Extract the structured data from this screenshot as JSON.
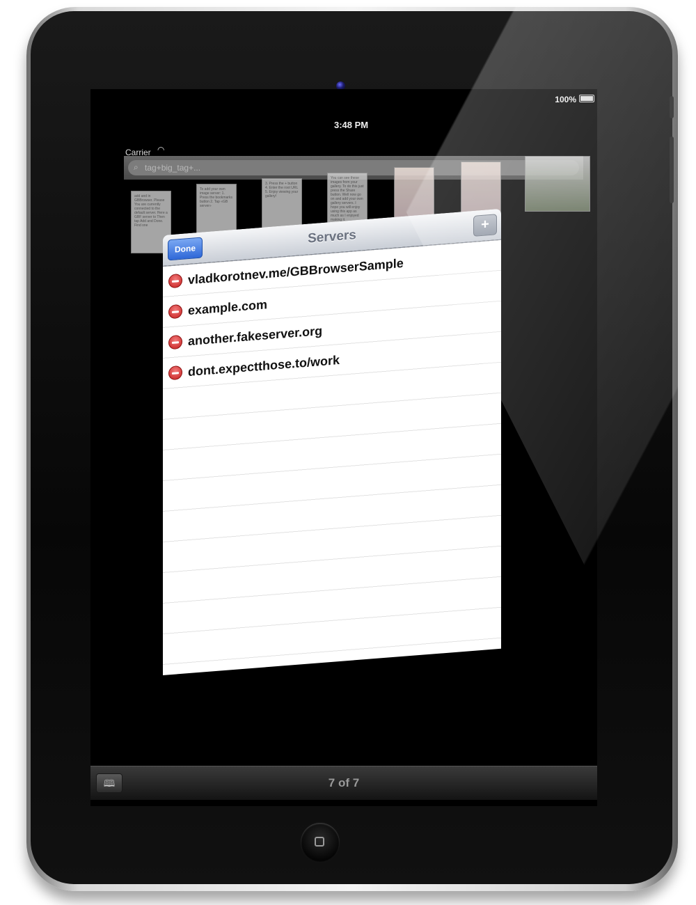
{
  "status_bar": {
    "carrier": "Carrier",
    "time": "3:48 PM",
    "battery": "100%"
  },
  "search": {
    "placeholder": "tag+big_tag+..."
  },
  "thumbnails": [
    {
      "text": "add and in GBBrowser. Please You are currently connected to the default server. Here a GBF server to Then tap Add and Done. Find one"
    },
    {
      "text": "To add your own image server: 1. Press the bookmarks button 2. Tap «GB server»"
    },
    {
      "text": "3. Press the + button 4. Enter the root URL 5. Enjoy viewing your gallery!"
    },
    {
      "text": "You can see these images from your gallery. To do this just press the Share button. Well now go on and add your own gallery servers. I hope you will enjoy using this app as much as I enjoyed making it."
    },
    {
      "text": ""
    },
    {
      "text": ""
    },
    {
      "text": ""
    }
  ],
  "popover": {
    "title": "Servers",
    "done_label": "Done",
    "add_label": "+",
    "servers": [
      "vladkorotnev.me/GBBrowserSample",
      "example.com",
      "another.fakeserver.org",
      "dont.expectthose.to/work"
    ]
  },
  "toolbar": {
    "page_count": "7 of 7"
  },
  "icons": {
    "wifi": "wifi-icon",
    "battery": "battery-icon",
    "search": "search-icon",
    "delete": "delete-icon",
    "bookmarks": "book-icon",
    "home": "home-button-icon"
  }
}
